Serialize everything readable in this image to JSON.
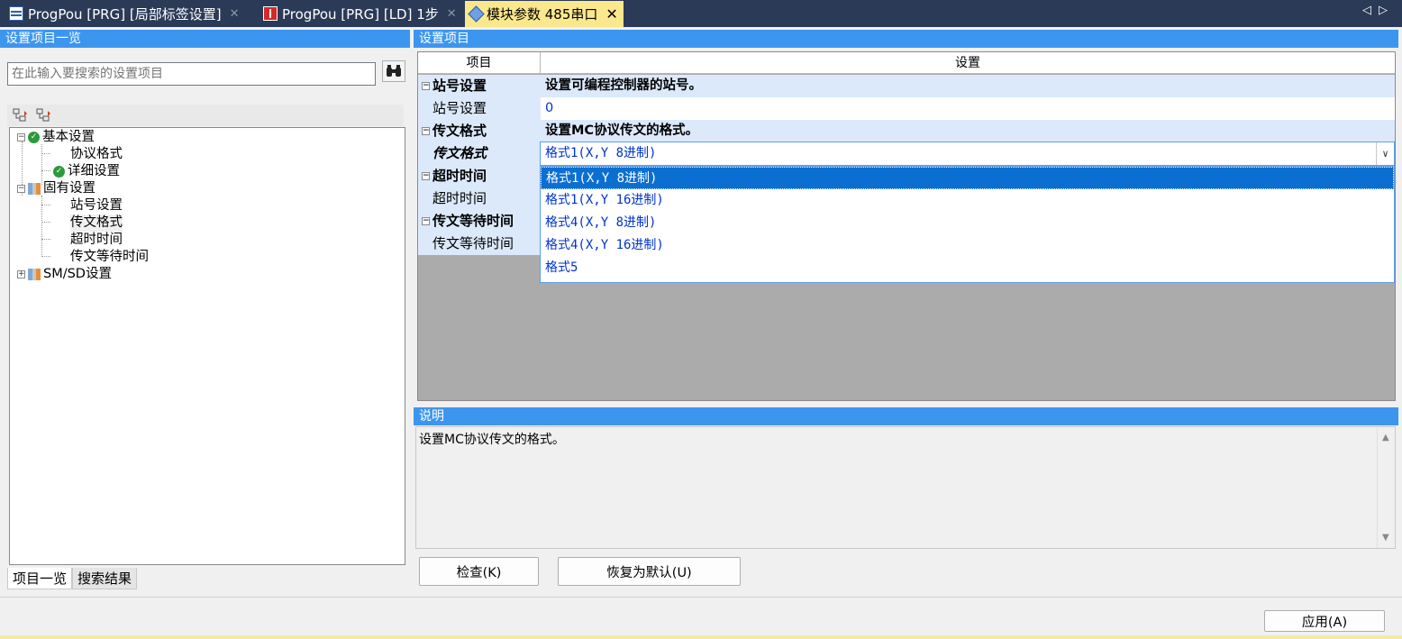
{
  "tabs": [
    {
      "label": "ProgPou [PRG] [局部标签设置]",
      "icon": "label-table-icon",
      "close": "✕"
    },
    {
      "label": "ProgPou [PRG] [LD] 1步",
      "icon": "ladder-icon",
      "close": "✕"
    },
    {
      "label": "模块参数 485串口",
      "icon": "module-parameter-icon",
      "close": "✕"
    }
  ],
  "tab_scroll": {
    "left": "◁",
    "right": "▷"
  },
  "left_panel": {
    "title": "设置项目一览",
    "search_placeholder": "在此输入要搜索的设置项目",
    "tree": [
      {
        "label": "基本设置",
        "expander": "−",
        "status": "ok"
      },
      {
        "label": "协议格式"
      },
      {
        "label": "详细设置",
        "status": "ok"
      },
      {
        "label": "固有设置",
        "expander": "−"
      },
      {
        "label": "站号设置"
      },
      {
        "label": "传文格式",
        "selected": true
      },
      {
        "label": "超时时间"
      },
      {
        "label": "传文等待时间"
      },
      {
        "label": "SM/SD设置",
        "expander": "+"
      }
    ],
    "bottom_tabs": [
      "项目一览",
      "搜索结果"
    ]
  },
  "right_panel": {
    "title": "设置项目",
    "columns": [
      "项目",
      "设置"
    ],
    "rows": [
      {
        "type": "group",
        "item": "站号设置",
        "setting": "设置可编程控制器的站号。"
      },
      {
        "type": "child",
        "item": "站号设置",
        "setting": "0"
      },
      {
        "type": "group",
        "item": "传文格式",
        "setting": "设置MC协议传文的格式。"
      },
      {
        "type": "child",
        "item": "传文格式",
        "setting": ""
      },
      {
        "type": "group",
        "item": "超时时间",
        "setting": ""
      },
      {
        "type": "child",
        "item": "超时时间",
        "setting": ""
      },
      {
        "type": "group",
        "item": "传文等待时间",
        "setting": ""
      },
      {
        "type": "child",
        "item": "传文等待时间",
        "setting": ""
      }
    ],
    "combo_value": "格式1(X,Y 8进制)",
    "combo_options": [
      "格式1(X,Y 8进制)",
      "格式1(X,Y 16进制)",
      "格式4(X,Y 8进制)",
      "格式4(X,Y 16进制)",
      "格式5"
    ],
    "highlighted_option_index": 0
  },
  "description": {
    "title": "说明",
    "text": "设置MC协议传文的格式。"
  },
  "buttons": {
    "check": "检查(K)",
    "restore_default": "恢复为默认(U)",
    "apply": "应用(A)"
  },
  "colors": {
    "tabstrip_bg": "#2b3a57",
    "active_tab_bg": "#fbe88c",
    "header_blue": "#3d96ee",
    "row_group_bg": "#dce9fb",
    "selection_blue": "#0a6fd1",
    "value_text_blue": "#0033cc"
  }
}
